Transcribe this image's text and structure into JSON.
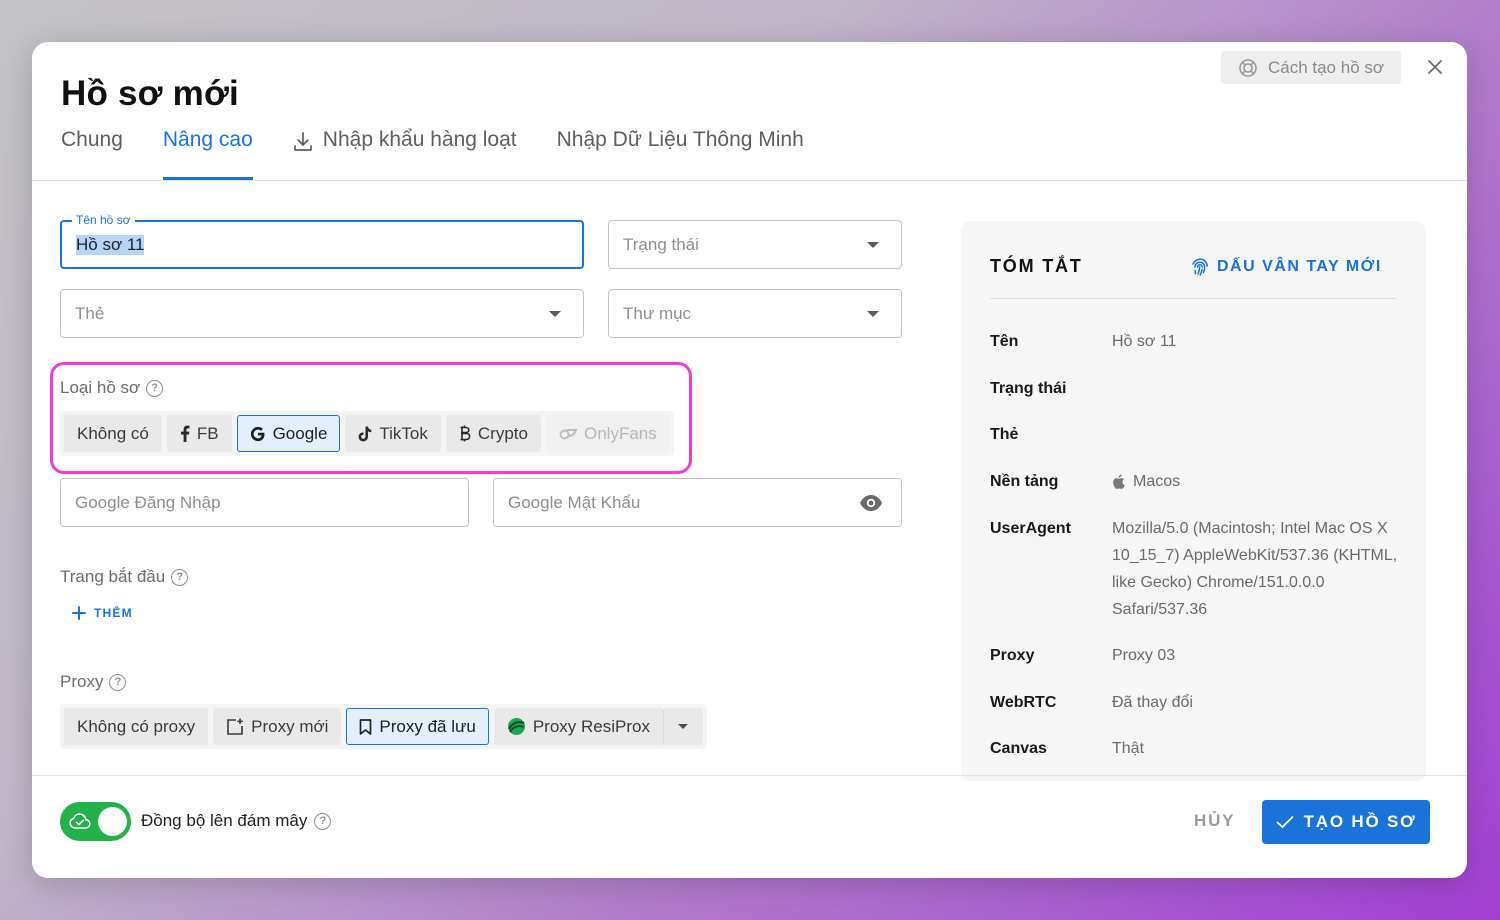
{
  "dialog": {
    "title": "Hồ sơ mới",
    "help_label": "Cách tạo hồ sơ"
  },
  "tabs": [
    {
      "label": "Chung"
    },
    {
      "label": "Nâng cao",
      "active": true
    },
    {
      "label": "Nhập khẩu hàng loạt"
    },
    {
      "label": "Nhập Dữ Liệu Thông Minh"
    }
  ],
  "form": {
    "name_label": "Tên hồ sơ",
    "name_value": "Hồ sơ 11",
    "status_placeholder": "Trạng thái",
    "tag_placeholder": "Thẻ",
    "folder_placeholder": "Thư mục",
    "profile_type_label": "Loại hồ sơ",
    "profile_types": [
      {
        "label": "Không có"
      },
      {
        "label": "FB"
      },
      {
        "label": "Google",
        "selected": true
      },
      {
        "label": "TikTok"
      },
      {
        "label": "Crypto"
      },
      {
        "label": "OnlyFans",
        "disabled": true
      }
    ],
    "google_login_placeholder": "Google Đăng Nhập",
    "google_password_placeholder": "Google Mật Khẩu",
    "start_page_label": "Trang bắt đầu",
    "add_label": "THÊM",
    "proxy_label": "Proxy",
    "proxy_options": [
      {
        "label": "Không có proxy"
      },
      {
        "label": "Proxy mới"
      },
      {
        "label": "Proxy đã lưu",
        "selected": true
      },
      {
        "label": "Proxy ResiProx"
      }
    ]
  },
  "summary": {
    "title": "TÓM TẮT",
    "fingerprint_label": "DẤU VÂN TAY MỚI",
    "rows": [
      {
        "label": "Tên",
        "value": "Hồ sơ 11"
      },
      {
        "label": "Trạng thái",
        "value": ""
      },
      {
        "label": "Thẻ",
        "value": ""
      },
      {
        "label": "Nền tảng",
        "value": "Macos"
      },
      {
        "label": "UserAgent",
        "value": "Mozilla/5.0 (Macintosh; Intel Mac OS X 10_15_7) AppleWebKit/537.36 (KHTML, like Gecko) Chrome/151.0.0.0 Safari/537.36"
      },
      {
        "label": "Proxy",
        "value": "Proxy 03"
      },
      {
        "label": "WebRTC",
        "value": "Đã thay đổi"
      },
      {
        "label": "Canvas",
        "value": "Thật"
      }
    ]
  },
  "footer": {
    "sync_label": "Đồng bộ lên đám mây",
    "sync_enabled": true,
    "cancel_label": "HỦY",
    "create_label": "TẠO HỒ SƠ"
  },
  "colors": {
    "accent": "#1a73d9",
    "toggle_on": "#22b24c",
    "highlight": "#ee3ed6"
  }
}
